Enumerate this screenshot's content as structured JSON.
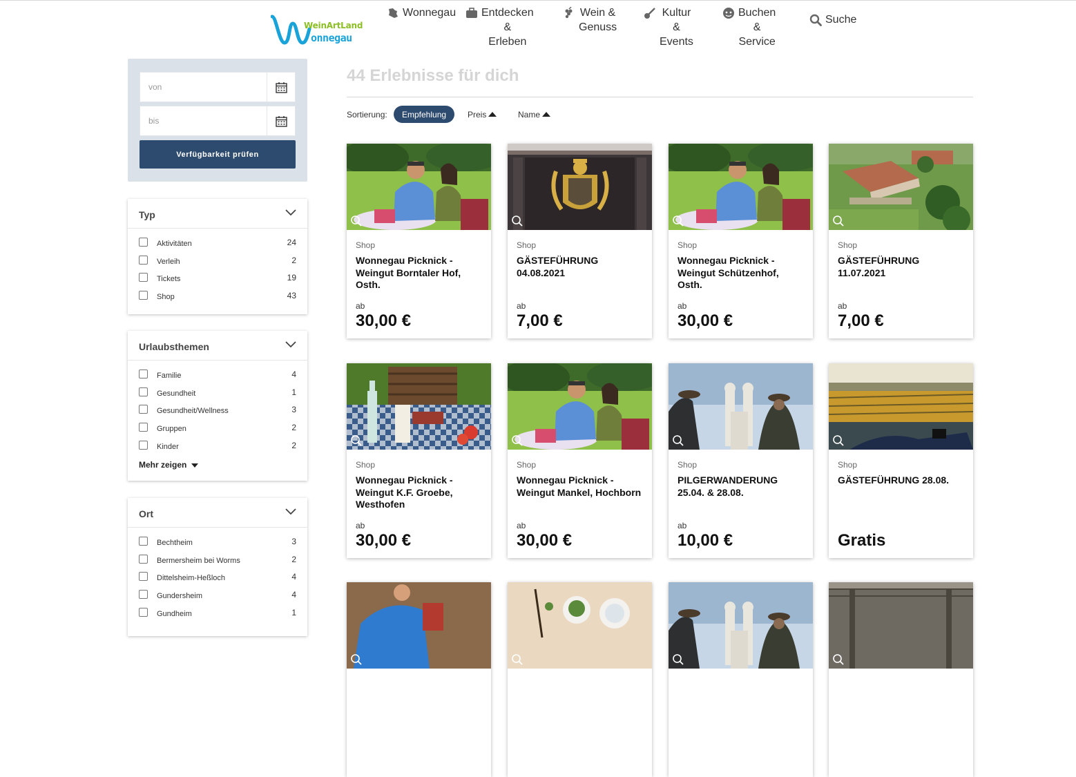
{
  "header": {
    "logo_line1": "WeinArtLand",
    "logo_line2": "onnegau",
    "nav": [
      {
        "label": "Wonnegau",
        "icon": "map-icon"
      },
      {
        "label": "Entdecken &\nErleben",
        "icon": "suitcase-icon"
      },
      {
        "label": "Wein &\nGenuss",
        "icon": "grapes-icon"
      },
      {
        "label": "Kultur &\nEvents",
        "icon": "guitar-icon"
      },
      {
        "label": "Buchen &\nService",
        "icon": "service-icon"
      },
      {
        "label": "Suche",
        "icon": "search-icon"
      }
    ]
  },
  "sidebar": {
    "date_from_placeholder": "von",
    "date_to_placeholder": "bis",
    "check_button": "Verfügbarkeit prüfen",
    "filters": [
      {
        "title": "Typ",
        "items": [
          {
            "label": "Aktivitäten",
            "count": "24"
          },
          {
            "label": "Verleih",
            "count": "2"
          },
          {
            "label": "Tickets",
            "count": "19"
          },
          {
            "label": "Shop",
            "count": "43"
          }
        ]
      },
      {
        "title": "Urlaubsthemen",
        "items": [
          {
            "label": "Familie",
            "count": "4"
          },
          {
            "label": "Gesundheit",
            "count": "1"
          },
          {
            "label": "Gesundheit/Wellness",
            "count": "3"
          },
          {
            "label": "Gruppen",
            "count": "2"
          },
          {
            "label": "Kinder",
            "count": "2"
          }
        ],
        "more": "Mehr zeigen"
      },
      {
        "title": "Ort",
        "items": [
          {
            "label": "Bechtheim",
            "count": "3"
          },
          {
            "label": "Bermersheim bei Worms",
            "count": "2"
          },
          {
            "label": "Dittelsheim-Heßloch",
            "count": "4"
          },
          {
            "label": "Gundersheim",
            "count": "4"
          },
          {
            "label": "Gundheim",
            "count": "1"
          }
        ]
      }
    ]
  },
  "main": {
    "result_title": "44 Erlebnisse für dich",
    "sort_label": "Sortierung:",
    "sort_options": [
      "Empfehlung",
      "Preis",
      "Name"
    ],
    "cards": [
      {
        "category": "Shop",
        "title": "Wonnegau Picknick - Weingut Borntaler Hof, Osth.",
        "prefix": "ab",
        "price": "30,00 €",
        "image": "picnic-couple"
      },
      {
        "category": "Shop",
        "title": "GÄSTEFÜHRUNG 04.08.2021",
        "prefix": "ab",
        "price": "7,00 €",
        "image": "coat-of-arms"
      },
      {
        "category": "Shop",
        "title": "Wonnegau Picknick - Weingut Schützenhof, Osth.",
        "prefix": "ab",
        "price": "30,00 €",
        "image": "picnic-couple"
      },
      {
        "category": "Shop",
        "title": "GÄSTEFÜHRUNG 11.07.2021",
        "prefix": "ab",
        "price": "7,00 €",
        "image": "aerial-estate"
      },
      {
        "category": "Shop",
        "title": "Wonnegau Picknick - Weingut K.F. Groebe, Westhofen",
        "prefix": "ab",
        "price": "30,00 €",
        "image": "picnic-basket"
      },
      {
        "category": "Shop",
        "title": "Wonnegau Picknick - Weingut Mankel, Hochborn",
        "prefix": "ab",
        "price": "30,00 €",
        "image": "picnic-couple"
      },
      {
        "category": "Shop",
        "title": "PILGERWANDERUNG 25.04. & 28.08.",
        "prefix": "ab",
        "price": "10,00 €",
        "image": "pilgrims-church"
      },
      {
        "category": "Shop",
        "title": "GÄSTEFÜHRUNG 28.08.",
        "prefix": "",
        "price": "Gratis",
        "image": "vineyard-relax"
      },
      {
        "category": "",
        "title": "",
        "prefix": "",
        "price": "",
        "image": "hiker-blue"
      },
      {
        "category": "",
        "title": "",
        "prefix": "",
        "price": "",
        "image": "herbs-table"
      },
      {
        "category": "",
        "title": "",
        "prefix": "",
        "price": "",
        "image": "pilgrims-church"
      },
      {
        "category": "",
        "title": "",
        "prefix": "",
        "price": "",
        "image": "barn-interior"
      }
    ]
  },
  "colors": {
    "primary": "#2d4a6f",
    "logo_green": "#8cbf26",
    "logo_blue": "#1aa3d9",
    "title_gray": "#d5d5d5"
  }
}
